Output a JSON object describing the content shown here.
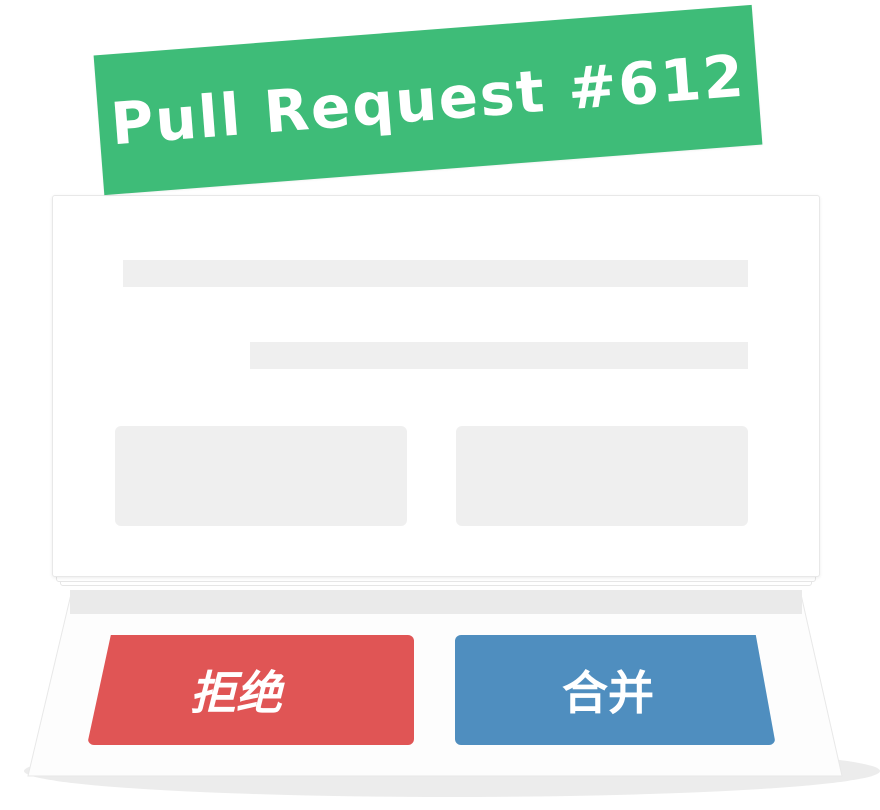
{
  "banner": {
    "title": "Pull Request #612"
  },
  "actions": {
    "reject_label": "拒绝",
    "merge_label": "合并"
  },
  "colors": {
    "banner": "#3ebc78",
    "reject": "#e05555",
    "merge": "#4f8ebf",
    "placeholder": "#efefef"
  }
}
